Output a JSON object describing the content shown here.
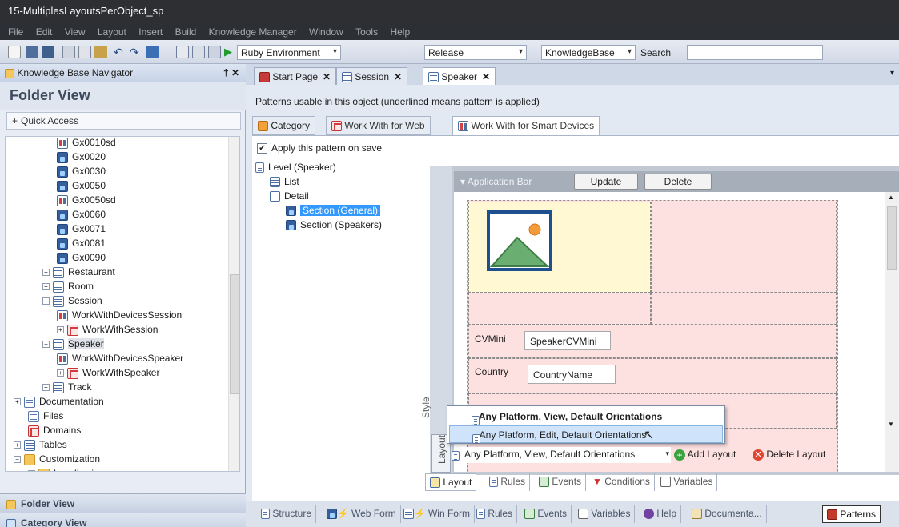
{
  "window": {
    "title": "15-MultiplesLayoutsPerObject_sp"
  },
  "menu": [
    "File",
    "Edit",
    "View",
    "Layout",
    "Insert",
    "Build",
    "Knowledge Manager",
    "Window",
    "Tools",
    "Help"
  ],
  "toolbar": {
    "environment": "Ruby Environment",
    "configuration": "Release",
    "kb_combo": "KnowledgeBase",
    "search_label": "Search",
    "search_value": ""
  },
  "left_panel": {
    "header": "Knowledge Base Navigator",
    "pin": "† ✕",
    "folder_view_title": "Folder View",
    "quick_access": "Quick Access",
    "tree": [
      {
        "label": "Gx0010sd",
        "icon": "smart-device-icon"
      },
      {
        "label": "Gx0020",
        "icon": "prompt-icon"
      },
      {
        "label": "Gx0030",
        "icon": "prompt-icon"
      },
      {
        "label": "Gx0050",
        "icon": "prompt-icon"
      },
      {
        "label": "Gx0050sd",
        "icon": "smart-device-icon"
      },
      {
        "label": "Gx0060",
        "icon": "prompt-icon"
      },
      {
        "label": "Gx0071",
        "icon": "prompt-icon"
      },
      {
        "label": "Gx0081",
        "icon": "prompt-icon"
      },
      {
        "label": "Gx0090",
        "icon": "prompt-icon"
      },
      {
        "label": "Restaurant",
        "icon": "transaction-icon"
      },
      {
        "label": "Room",
        "icon": "transaction-icon"
      },
      {
        "label": "Session",
        "icon": "transaction-icon"
      },
      {
        "label": "WorkWithDevicesSession",
        "icon": "smart-device-icon"
      },
      {
        "label": "WorkWithSession",
        "icon": "work-with-icon"
      },
      {
        "label": "Speaker",
        "icon": "transaction-icon"
      },
      {
        "label": "WorkWithDevicesSpeaker",
        "icon": "smart-device-icon"
      },
      {
        "label": "WorkWithSpeaker",
        "icon": "work-with-icon"
      },
      {
        "label": "Track",
        "icon": "transaction-icon"
      },
      {
        "label": "Documentation",
        "icon": "documentation-icon"
      },
      {
        "label": "Files",
        "icon": "files-icon"
      },
      {
        "label": "Domains",
        "icon": "domains-icon"
      },
      {
        "label": "Tables",
        "icon": "tables-icon"
      },
      {
        "label": "Customization",
        "icon": "folder-icon"
      },
      {
        "label": "Localization",
        "icon": "localization-icon"
      }
    ],
    "bottom_tabs": [
      "Folder View",
      "Category View"
    ]
  },
  "doc_tabs": [
    {
      "label": "Start Page",
      "icon": "gx-icon"
    },
    {
      "label": "Session",
      "icon": "transaction-icon"
    },
    {
      "label": "Speaker",
      "icon": "transaction-icon"
    }
  ],
  "patterns": {
    "caption": "Patterns usable in this object (underlined means pattern is applied)",
    "tabs": [
      "Category",
      "Work With for Web",
      "Work With for Smart Devices"
    ],
    "apply_label": "Apply this pattern on save",
    "apply_checked": true,
    "level_tree": [
      "Level (Speaker)",
      "List",
      "Detail",
      "Section (General)",
      "Section (Speakers)"
    ]
  },
  "designer": {
    "side_tabs": [
      "Style",
      "Layout"
    ],
    "appbar_label": "Application Bar",
    "update_button": "Update",
    "delete_button": "Delete",
    "fields": [
      {
        "label": "CVMini",
        "control": "SpeakerCVMini"
      },
      {
        "label": "Country",
        "control": "CountryName"
      }
    ]
  },
  "layout_dropdown": {
    "options": [
      "Any Platform, View, Default Orientations",
      "Any Platform, Edit, Default Orientations"
    ],
    "selected": "Any Platform, View, Default Orientations",
    "add_layout": "Add Layout",
    "delete_layout": "Delete Layout"
  },
  "sub_tabs": [
    "Layout",
    "Rules",
    "Events",
    "Conditions",
    "Variables"
  ],
  "object_tabs": [
    "Structure",
    "Web Form",
    "Win Form",
    "Rules",
    "Events",
    "Variables",
    "Help",
    "Documenta...",
    "Patterns"
  ],
  "colors": {
    "selection": "#3399ff",
    "cell_pink": "#fde0e0",
    "cell_yellow": "#fff8d2"
  }
}
